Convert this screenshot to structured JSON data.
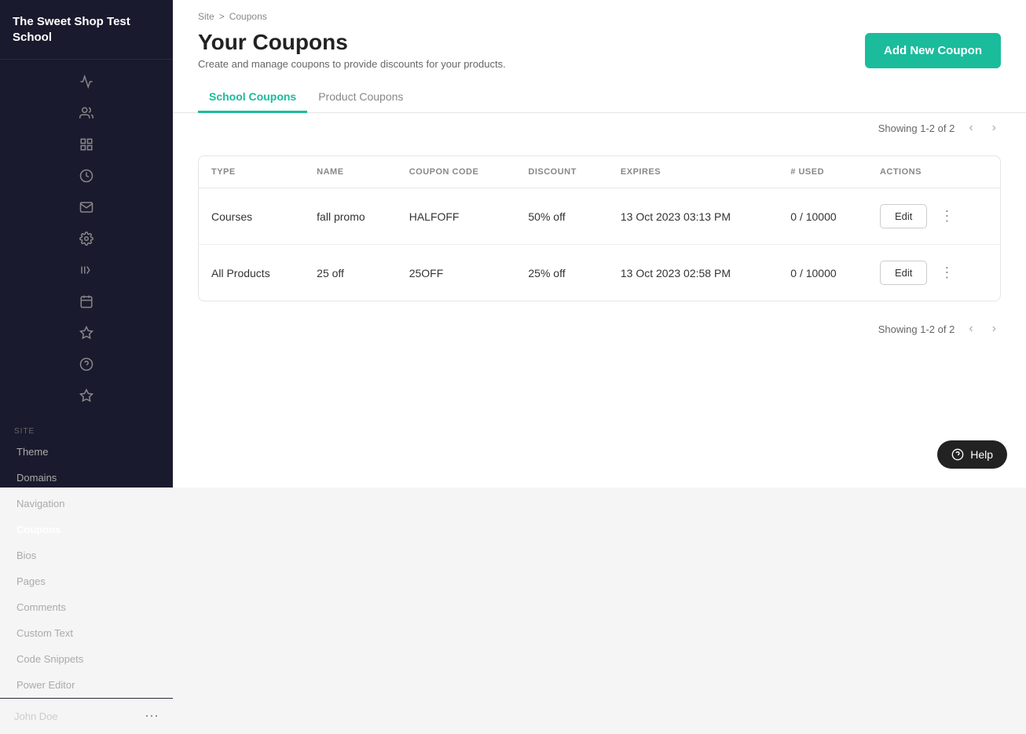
{
  "sidebar": {
    "logo": "The Sweet Shop Test School",
    "section_label": "SITE",
    "nav_items": [
      {
        "id": "theme",
        "label": "Theme"
      },
      {
        "id": "domains",
        "label": "Domains"
      },
      {
        "id": "navigation",
        "label": "Navigation"
      },
      {
        "id": "coupons",
        "label": "Coupons",
        "active": true
      },
      {
        "id": "bios",
        "label": "Bios"
      },
      {
        "id": "pages",
        "label": "Pages"
      },
      {
        "id": "comments",
        "label": "Comments"
      },
      {
        "id": "custom-text",
        "label": "Custom Text"
      },
      {
        "id": "code-snippets",
        "label": "Code Snippets"
      },
      {
        "id": "power-editor",
        "label": "Power Editor"
      }
    ],
    "user_name": "John Doe"
  },
  "breadcrumb": {
    "site": "Site",
    "separator": ">",
    "current": "Coupons"
  },
  "page": {
    "title": "Your Coupons",
    "subtitle": "Create and manage coupons to provide discounts for your products.",
    "add_button_label": "Add New Coupon"
  },
  "tabs": [
    {
      "id": "school-coupons",
      "label": "School Coupons",
      "active": true
    },
    {
      "id": "product-coupons",
      "label": "Product Coupons",
      "active": false
    }
  ],
  "pagination": {
    "showing": "Showing 1-2 of 2"
  },
  "table": {
    "columns": [
      "TYPE",
      "NAME",
      "COUPON CODE",
      "DISCOUNT",
      "EXPIRES",
      "# USED",
      "ACTIONS"
    ],
    "rows": [
      {
        "type": "Courses",
        "name": "fall promo",
        "coupon_code": "HALFOFF",
        "discount": "50% off",
        "expires": "13 Oct 2023 03:13 PM",
        "used": "0 / 10000",
        "edit_label": "Edit"
      },
      {
        "type": "All Products",
        "name": "25 off",
        "coupon_code": "25OFF",
        "discount": "25% off",
        "expires": "13 Oct 2023 02:58 PM",
        "used": "0 / 10000",
        "edit_label": "Edit"
      }
    ]
  },
  "help": {
    "label": "Help"
  },
  "icons": {
    "analytics": "📊",
    "users": "👥",
    "dashboard": "⊞",
    "revenue": "◎",
    "mail": "✉",
    "settings": "⚙",
    "library": "|||",
    "calendar": "▦",
    "integrations": "⬡",
    "help_circle": "?",
    "badge": "⬟"
  }
}
